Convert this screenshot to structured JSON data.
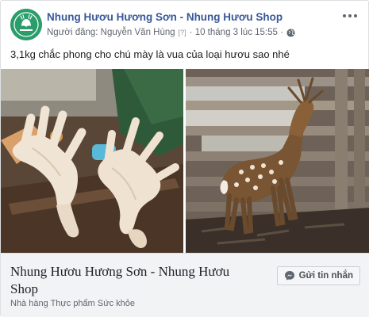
{
  "post": {
    "page_name": "Nhung Hươu Hương Sơn - Nhung Hươu Shop",
    "posted_by": "Người đăng: Nguyễn Văn Hùng",
    "posted_by_tag": "[?]",
    "timestamp": "· 10 tháng 3 lúc 15:55 ·",
    "privacy_icon": "globe-icon",
    "more_icon": "more-options-icon",
    "text": "3,1kg chắc phong cho chú mày là vua của loại hươu sao nhé"
  },
  "photos": [
    {
      "id": "left",
      "subject": "antlers-photo"
    },
    {
      "id": "right",
      "subject": "deer-photo"
    }
  ],
  "footer": {
    "title": "Nhung Hươu Hương Sơn - Nhung Hươu Shop",
    "subtitle": "Nhà hàng Thực phẩm Sức khỏe",
    "button_label": "Gửi tin nhắn",
    "button_icon": "messenger-icon"
  },
  "colors": {
    "link": "#385898",
    "meta": "#616770",
    "footer_bg": "#f2f3f5",
    "avatar": "#2a9d6a"
  }
}
